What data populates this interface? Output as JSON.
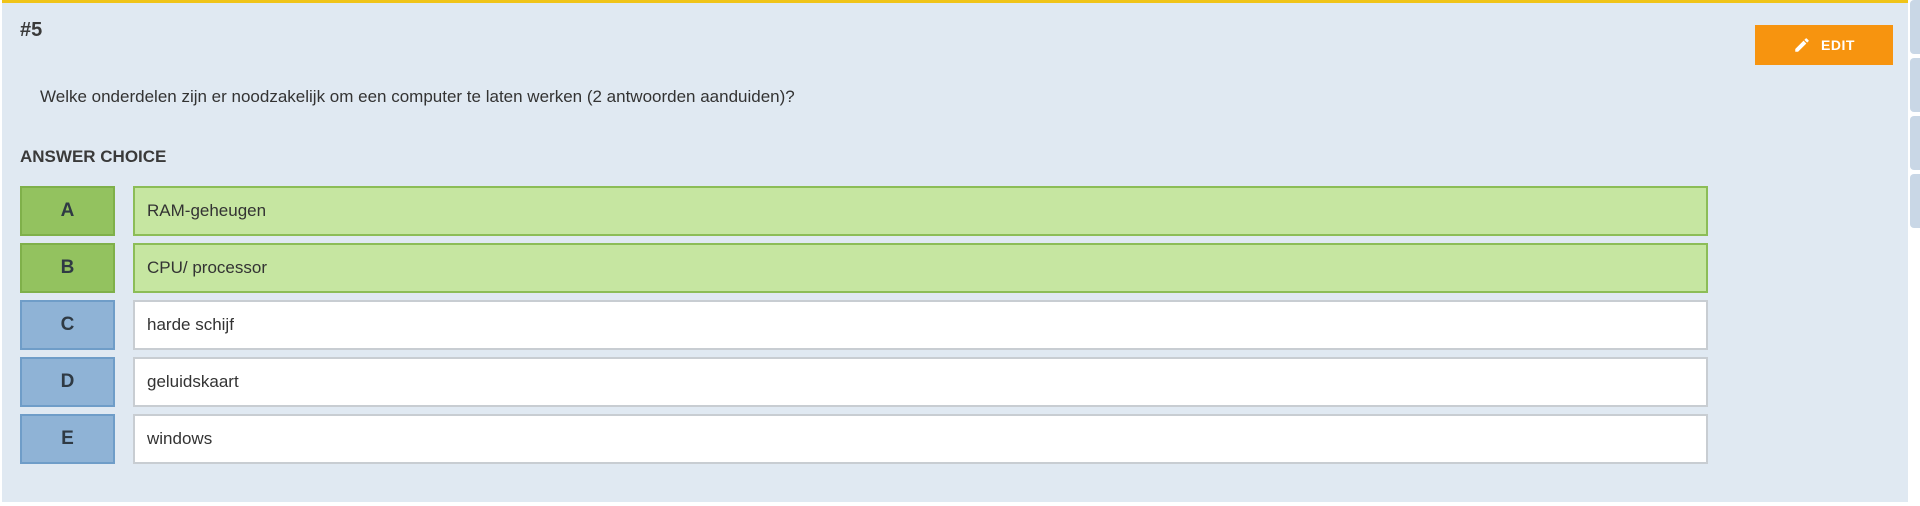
{
  "question": {
    "number": "#5",
    "text": "Welke onderdelen zijn er noodzakelijk om een computer te laten werken (2 antwoorden aanduiden)?"
  },
  "toolbar": {
    "edit_label": "EDIT",
    "edit_icon": "pencil-icon"
  },
  "answers": {
    "section_label": "ANSWER CHOICE",
    "choices": [
      {
        "letter": "A",
        "text": "RAM-geheugen",
        "correct": true
      },
      {
        "letter": "B",
        "text": "CPU/ processor",
        "correct": true
      },
      {
        "letter": "C",
        "text": "harde schijf",
        "correct": false
      },
      {
        "letter": "D",
        "text": "geluidskaart",
        "correct": false
      },
      {
        "letter": "E",
        "text": "windows",
        "correct": false
      }
    ]
  },
  "colors": {
    "panel_bg": "#e0e9f2",
    "top_accent": "#f0c419",
    "edit_button": "#f7940f",
    "correct_letter": "#93c25f",
    "correct_text": "#c6e6a1",
    "incorrect_letter": "#8fb3d6"
  }
}
